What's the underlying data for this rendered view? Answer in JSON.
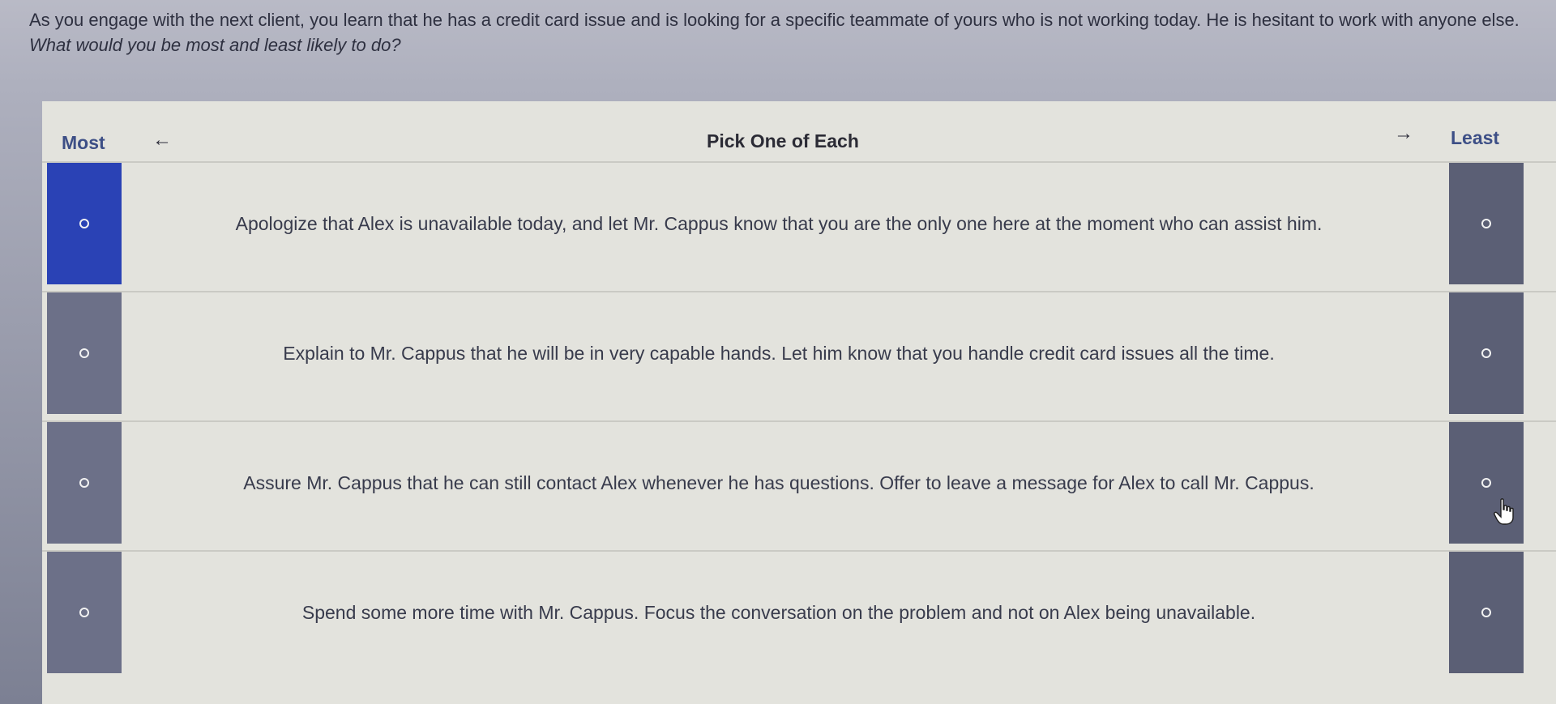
{
  "prompt": {
    "line1": "As you engage with the next client, you learn that he has a credit card issue and is looking for a specific teammate of yours who is not working today. He is hesitant to work with anyone else.",
    "question": "What would you be most and least likely to do?"
  },
  "header": {
    "most": "Most",
    "center": "Pick One of Each",
    "least": "Least",
    "left_arrow": "←",
    "right_arrow": "→"
  },
  "options": [
    {
      "text": "Apologize that Alex is unavailable today, and let Mr. Cappus know that you are the only one here at the moment who can assist him.",
      "most_selected": true
    },
    {
      "text": "Explain to Mr. Cappus that he will be in very capable hands. Let him know that you handle credit card issues all the time.",
      "most_selected": false
    },
    {
      "text": "Assure Mr. Cappus that he can still contact Alex whenever he has questions. Offer to leave a message for Alex to call Mr. Cappus.",
      "most_selected": false
    },
    {
      "text": "Spend some more time with Mr. Cappus. Focus the conversation on the problem and not on Alex being unavailable.",
      "most_selected": false
    }
  ],
  "colors": {
    "most_selected": "#2a42b5",
    "radio_cell": "#6c7088",
    "least_cell": "#5b5f75",
    "panel": "#e3e3dd"
  },
  "icons": {
    "left_arrow": "arrow-left-icon",
    "right_arrow": "arrow-right-icon",
    "cursor": "hand-pointer-icon"
  }
}
